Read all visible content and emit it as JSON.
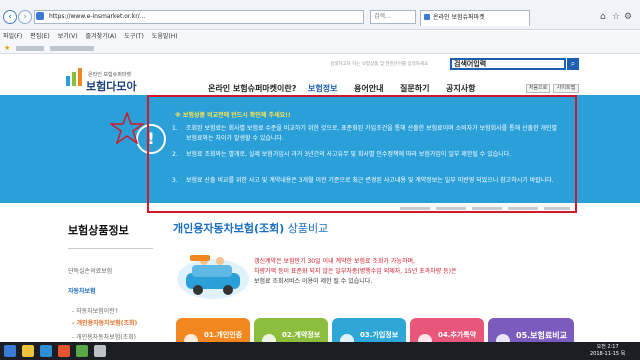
{
  "browser": {
    "url": "https://www.e-insmarket.or.kr/...",
    "tab_title": "온라인 보험슈퍼마켓",
    "search_placeholder": "검색...",
    "menu": [
      "파일(F)",
      "편집(E)",
      "보기(V)",
      "즐겨찾기(A)",
      "도구(T)",
      "도움말(H)"
    ]
  },
  "site": {
    "logo_sub": "온라인 보험슈퍼마켓",
    "logo_text": "보험다모아",
    "search_hint": "검색하고자 하는 보험상품 및 연관단어를 입력하세요",
    "search_value": "검색어입력",
    "nav": [
      "온라인 보험슈퍼마켓이란?",
      "보험정보",
      "용어안내",
      "질문하기",
      "공지사항"
    ],
    "btn_first": "처음으로",
    "btn_sitemap": "사이트맵"
  },
  "notice": {
    "title": "※ 보험상품 비교전에 반드시 확인해 주세요!!",
    "items": [
      {
        "num": "1.",
        "text": "조회된 보험료는 회사별 보험료 수준을 비교하기 위한 것으로, 표준화된 가입조건을 통해 산출한 보험료이며 소비자가 보험회사를 통해 산출한 개인별 보험료와는 차이가 발생할 수 있습니다."
      },
      {
        "num": "2.",
        "text": "보험료 조회와는 별개로, 실제 보험가입시 과거 3년간의 사고유무 및 회사별 인수정책에 따라 보험가입이 일부 제한될 수 있습니다."
      },
      {
        "num": "3.",
        "text": "보험료 산출 비교를 위한 사고 및 계약내용은 3개월 이전 기준으로 최근 변경된 사고내용 및 계약정보는 일부 미반영 되었으니 참고하시기 바랍니다."
      }
    ],
    "alert_symbol": "!"
  },
  "sidebar": {
    "title": "보험상품정보",
    "items": [
      "단독실손의료보험",
      "자동차보험",
      "- 자동차보험이란?",
      "- 개인용자동차보험(조회)",
      "- 개인용자동차보험(조회)"
    ]
  },
  "main": {
    "title_strong": "개인용자동차보험(조회)",
    "title_rest": " 상품비교",
    "note_red": "갱신계약은 보험만기 30일 이내 계약한 보험료 조회가 가능하며,",
    "note_red2": "차량가액 등이 표준화 되지 않은 일부차종(병행수입 외제차, 15년 초과차량 등)은",
    "note_black": "보험료 조회서비스 이용이 제한 될 수 있습니다.",
    "tiles": [
      "01.개인인증",
      "02.계약정보",
      "03.가입정보",
      "04.추가특약",
      "05.보험료비교"
    ],
    "tile_colors": [
      "#f2861f",
      "#8cbd3c",
      "#2ea7d6",
      "#e8567a",
      "#7b5bbd"
    ]
  },
  "taskbar": {
    "time": "오전 2:17",
    "date": "2018-11-15 목"
  }
}
